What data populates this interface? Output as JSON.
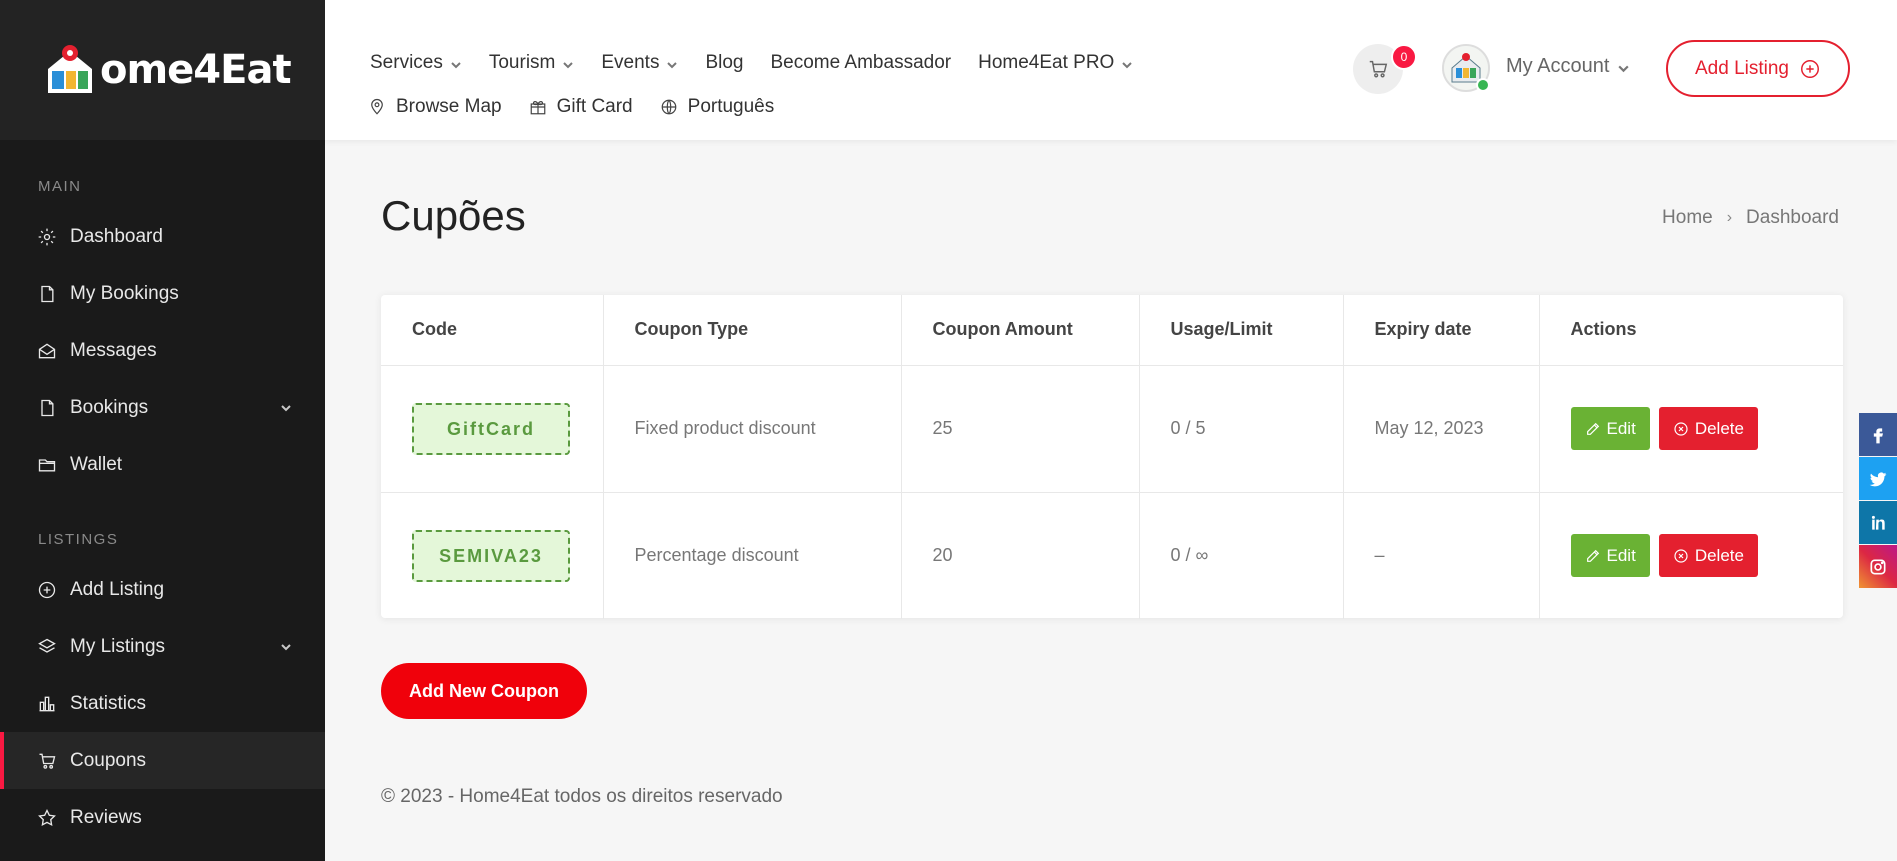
{
  "brand": {
    "logo_text": "ome4Eat"
  },
  "sidebar": {
    "sections": [
      {
        "title": "Main",
        "items": [
          {
            "label": "Dashboard"
          },
          {
            "label": "My Bookings"
          },
          {
            "label": "Messages"
          },
          {
            "label": "Bookings"
          },
          {
            "label": "Wallet"
          }
        ]
      },
      {
        "title": "Listings",
        "items": [
          {
            "label": "Add Listing"
          },
          {
            "label": "My Listings"
          },
          {
            "label": "Statistics"
          },
          {
            "label": "Coupons"
          },
          {
            "label": "Reviews"
          }
        ]
      }
    ]
  },
  "header": {
    "menu": [
      "Services",
      "Tourism",
      "Events",
      "Blog",
      "Become Ambassador",
      "Home4Eat PRO"
    ],
    "submenu": [
      "Browse Map",
      "Gift Card",
      "Português"
    ],
    "cart_count": "0",
    "account_label": "My Account",
    "add_listing_label": "Add Listing"
  },
  "page": {
    "title": "Cupões",
    "breadcrumb": [
      "Home",
      "Dashboard"
    ]
  },
  "table": {
    "headers": [
      "Code",
      "Coupon Type",
      "Coupon Amount",
      "Usage/Limit",
      "Expiry date",
      "Actions"
    ],
    "rows": [
      {
        "code": "GiftCard",
        "type": "Fixed product discount",
        "amount": "25",
        "usage": "0 / 5",
        "expiry": "May 12, 2023"
      },
      {
        "code": "SEMIVA23",
        "type": "Percentage discount",
        "amount": "20",
        "usage": "0 / ∞",
        "expiry": "–"
      }
    ],
    "edit_label": "Edit",
    "delete_label": "Delete"
  },
  "add_coupon_label": "Add New Coupon",
  "footer_text": "© 2023 - Home4Eat todos os direitos reservado",
  "colors": {
    "accent": "#f91942",
    "edit": "#6ab234",
    "delete": "#e4202f"
  }
}
